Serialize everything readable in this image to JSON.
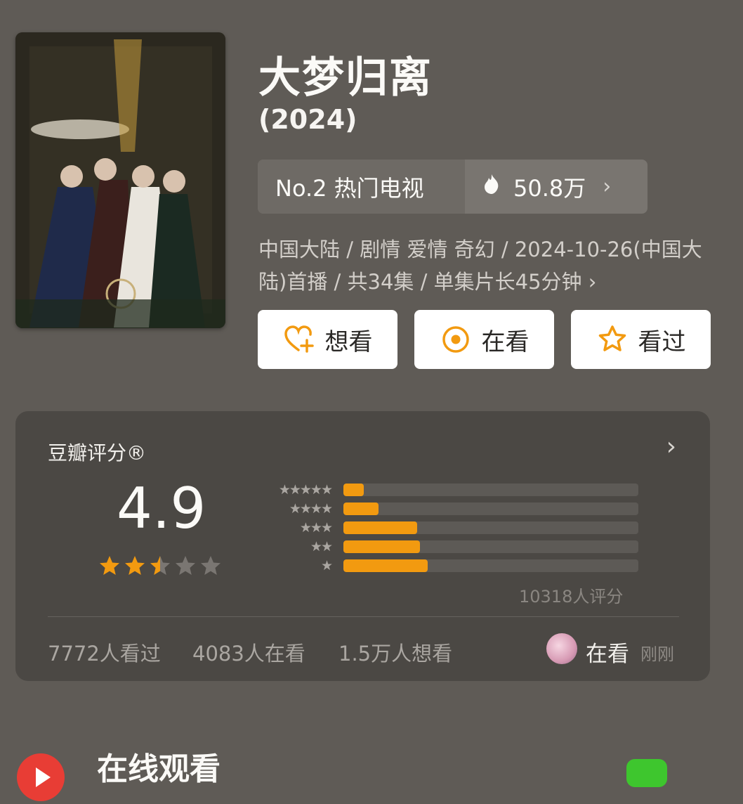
{
  "title": "大梦归离",
  "year": "(2024)",
  "rank": {
    "label": "No.2 热门电视",
    "heat": "50.8万"
  },
  "meta": "中国大陆 / 剧情 爱情 奇幻 / 2024-10-26(中国大陆)首播 / 共34集 / 单集片长45分钟 ›",
  "buttons": [
    {
      "label": "想看",
      "icon": "heart-plus-icon"
    },
    {
      "label": "在看",
      "icon": "target-icon"
    },
    {
      "label": "看过",
      "icon": "star-icon"
    }
  ],
  "rating": {
    "title": "豆瓣评分®",
    "score": "4.9",
    "stars": 2.5,
    "distribution": [
      {
        "stars": "★★★★★",
        "fraction": 0.07
      },
      {
        "stars": "★★★★",
        "fraction": 0.12
      },
      {
        "stars": "★★★",
        "fraction": 0.25
      },
      {
        "stars": "★★",
        "fraction": 0.26
      },
      {
        "stars": "★",
        "fraction": 0.285
      }
    ],
    "count_text": "10318人评分",
    "footer": {
      "watched": "7772人看过",
      "watching": "4083人在看",
      "want": "1.5万人想看",
      "status": "在看",
      "time": "刚刚"
    }
  },
  "online": {
    "title": "在线观看"
  },
  "colors": {
    "accent": "#f29a10",
    "background": "#5f5b56",
    "play": "#e83d35",
    "green": "#3ec62e"
  }
}
